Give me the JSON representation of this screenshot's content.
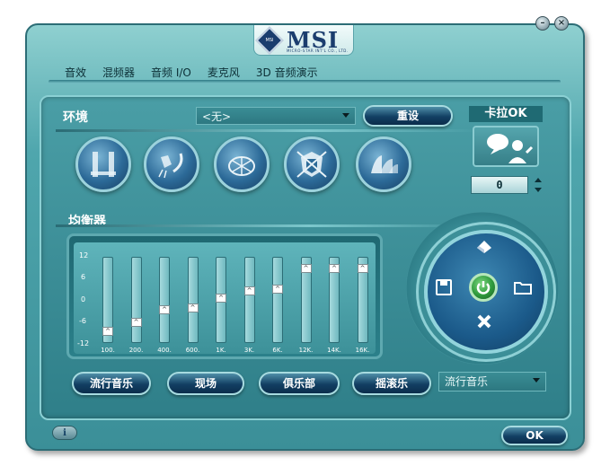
{
  "window": {
    "brand": "MSI",
    "brand_sub": "MICRO-STAR INT'L CO., LTD."
  },
  "tabs": [
    {
      "label": "音效"
    },
    {
      "label": "混频器"
    },
    {
      "label": "音频 I/O"
    },
    {
      "label": "麦克风"
    },
    {
      "label": "3D 音频演示"
    }
  ],
  "environment": {
    "title": "环境",
    "selected": "<无>",
    "reset_label": "重设",
    "icons": [
      "pipes-environment-icon",
      "shower-environment-icon",
      "stadium-environment-icon",
      "colosseum-environment-icon",
      "opera-house-environment-icon"
    ]
  },
  "karaoke": {
    "title": "卡拉OK",
    "value": "0"
  },
  "equalizer": {
    "title": "均衡器",
    "db_labels": [
      "12",
      "6",
      "0",
      "-6",
      "-12"
    ],
    "bands": [
      {
        "freq": "100.",
        "gain": -10
      },
      {
        "freq": "200.",
        "gain": -7
      },
      {
        "freq": "400.",
        "gain": -3
      },
      {
        "freq": "600.",
        "gain": -2.5
      },
      {
        "freq": "1K.",
        "gain": 0.5
      },
      {
        "freq": "3K.",
        "gain": 3
      },
      {
        "freq": "6K.",
        "gain": 3.5
      },
      {
        "freq": "12K.",
        "gain": 10
      },
      {
        "freq": "14K.",
        "gain": 10
      },
      {
        "freq": "16K.",
        "gain": 10
      }
    ],
    "presets": [
      "流行音乐",
      "现场",
      "俱乐部",
      "摇滚乐"
    ],
    "preset_selected": "流行音乐"
  },
  "footer": {
    "ok_label": "OK"
  },
  "colors": {
    "panel": "#3b8f98",
    "button_dark": "#123f63",
    "power_green": "#2e9a3c"
  }
}
